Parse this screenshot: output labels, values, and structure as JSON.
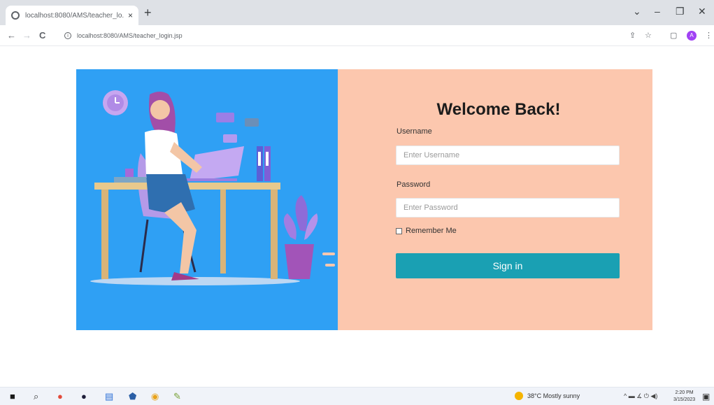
{
  "browser": {
    "tab_title": "localhost:8080/AMS/teacher_lo...",
    "new_tab": "+",
    "tab_close": "×",
    "url": "localhost:8080/AMS/teacher_login.jsp",
    "back": "←",
    "forward": "→",
    "reload": "C",
    "profile_initial": "A"
  },
  "window": {
    "chevron": "⌄",
    "minimize": "–",
    "maximize": "❐",
    "close": "✕"
  },
  "login": {
    "title": "Welcome Back!",
    "username_label": "Username",
    "username_placeholder": "Enter Username",
    "password_label": "Password",
    "password_placeholder": "Enter Password",
    "remember_label": "Remember Me",
    "signin_label": "Sign in"
  },
  "taskbar": {
    "weather": "38°C  Mostly sunny",
    "time": "2:20 PM",
    "date": "3/15/2023"
  },
  "colors": {
    "left_panel": "#2fa0f4",
    "right_panel": "#fcc7ae",
    "button": "#1aa0b3"
  }
}
